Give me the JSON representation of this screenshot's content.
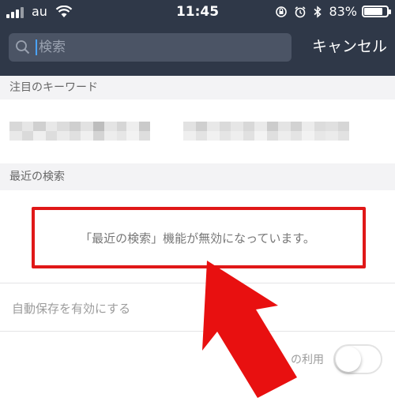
{
  "status_bar": {
    "carrier": "au",
    "time": "11:45",
    "battery": "83%",
    "battery_level": 0.83
  },
  "search": {
    "placeholder": "検索",
    "cancel_label": "キャンセル"
  },
  "sections": {
    "featured_keywords": "注目のキーワード",
    "recent_searches": "最近の検索"
  },
  "recent": {
    "message": "「最近の検索」機能が無効になっています。"
  },
  "settings": {
    "autosave_label": "自動保存を有効にする",
    "usage_label": "の利用",
    "toggle_on": false
  },
  "colors": {
    "header_bg": "#2f3848",
    "highlight": "#e01818",
    "section_bg": "#f3f3f5"
  },
  "icons": {
    "search": "search-icon",
    "wifi": "wifi-icon",
    "arrow": "pointer-arrow"
  }
}
